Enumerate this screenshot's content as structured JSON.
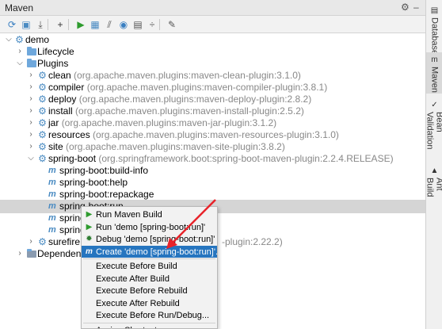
{
  "titlebar": {
    "title": "Maven",
    "settings_icon": "gear-icon",
    "hide_icon": "minimize-icon"
  },
  "toolbar": {
    "buttons": [
      {
        "name": "reload-icon",
        "glyph": "⟳",
        "color": "#3a7fc1"
      },
      {
        "name": "add-project-icon",
        "glyph": "▣",
        "color": "#4a8bc2"
      },
      {
        "name": "download-icon",
        "glyph": "⤓",
        "color": "#555555"
      },
      {
        "name": "add-icon",
        "glyph": "+",
        "color": "#333333"
      },
      {
        "name": "run-icon",
        "glyph": "▶",
        "color": "#2e9b2e"
      },
      {
        "name": "execute-goal-icon",
        "glyph": "▦",
        "color": "#4a8bc2"
      },
      {
        "name": "toggle-offline-icon",
        "glyph": "⫽",
        "color": "#555555"
      },
      {
        "name": "skip-tests-icon",
        "glyph": "◉",
        "color": "#3a7fc1"
      },
      {
        "name": "show-dependencies-icon",
        "glyph": "▤",
        "color": "#555555"
      },
      {
        "name": "collapse-all-icon",
        "glyph": "÷",
        "color": "#555555"
      },
      {
        "name": "maven-settings-icon",
        "glyph": "✎",
        "color": "#555555"
      }
    ]
  },
  "tree": {
    "root": "demo",
    "lifecycle": "Lifecycle",
    "plugins": "Plugins",
    "plugin_items": [
      {
        "name": "clean",
        "detail": "(org.apache.maven.plugins:maven-clean-plugin:3.1.0)"
      },
      {
        "name": "compiler",
        "detail": "(org.apache.maven.plugins:maven-compiler-plugin:3.8.1)"
      },
      {
        "name": "deploy",
        "detail": "(org.apache.maven.plugins:maven-deploy-plugin:2.8.2)"
      },
      {
        "name": "install",
        "detail": "(org.apache.maven.plugins:maven-install-plugin:2.5.2)"
      },
      {
        "name": "jar",
        "detail": "(org.apache.maven.plugins:maven-jar-plugin:3.1.2)"
      },
      {
        "name": "resources",
        "detail": "(org.apache.maven.plugins:maven-resources-plugin:3.1.0)"
      },
      {
        "name": "site",
        "detail": "(org.apache.maven.plugins:maven-site-plugin:3.8.2)"
      }
    ],
    "spring_boot": {
      "name": "spring-boot",
      "detail": "(org.springframework.boot:spring-boot-maven-plugin:2.2.4.RELEASE)"
    },
    "goals": [
      "spring-boot:build-info",
      "spring-boot:help",
      "spring-boot:repackage",
      "spring-boot:run",
      "spring",
      "spring"
    ],
    "surefire": {
      "name": "surefire",
      "detail": "(o"
    },
    "surefire_tail": "-plugin:2.22.2)",
    "dependencies": "Dependencies"
  },
  "context_menu": {
    "items": [
      {
        "label": "Run Maven Build",
        "icon": "run-icon"
      },
      {
        "label": "Run 'demo [spring-boot:run]'",
        "icon": "run-icon"
      },
      {
        "label": "Debug 'demo [spring-boot:run]'",
        "icon": "debug-icon"
      },
      {
        "label": "Create 'demo [spring-boot:run]'...",
        "icon": "maven-icon"
      },
      {
        "label": "Execute Before Build",
        "icon": ""
      },
      {
        "label": "Execute After Build",
        "icon": ""
      },
      {
        "label": "Execute Before Rebuild",
        "icon": ""
      },
      {
        "label": "Execute After Rebuild",
        "icon": ""
      },
      {
        "label": "Execute Before Run/Debug...",
        "icon": ""
      },
      {
        "label": "Assign Shortcut...",
        "icon": ""
      }
    ],
    "highlighted_index": 3
  },
  "sidebar": {
    "tabs": [
      "Database",
      "Maven",
      "Bean Validation",
      "Ant Build"
    ],
    "active": "Maven"
  },
  "colors": {
    "highlight": "#2675bf",
    "arrow": "#e8232a",
    "accent": "#4a8bc2"
  }
}
